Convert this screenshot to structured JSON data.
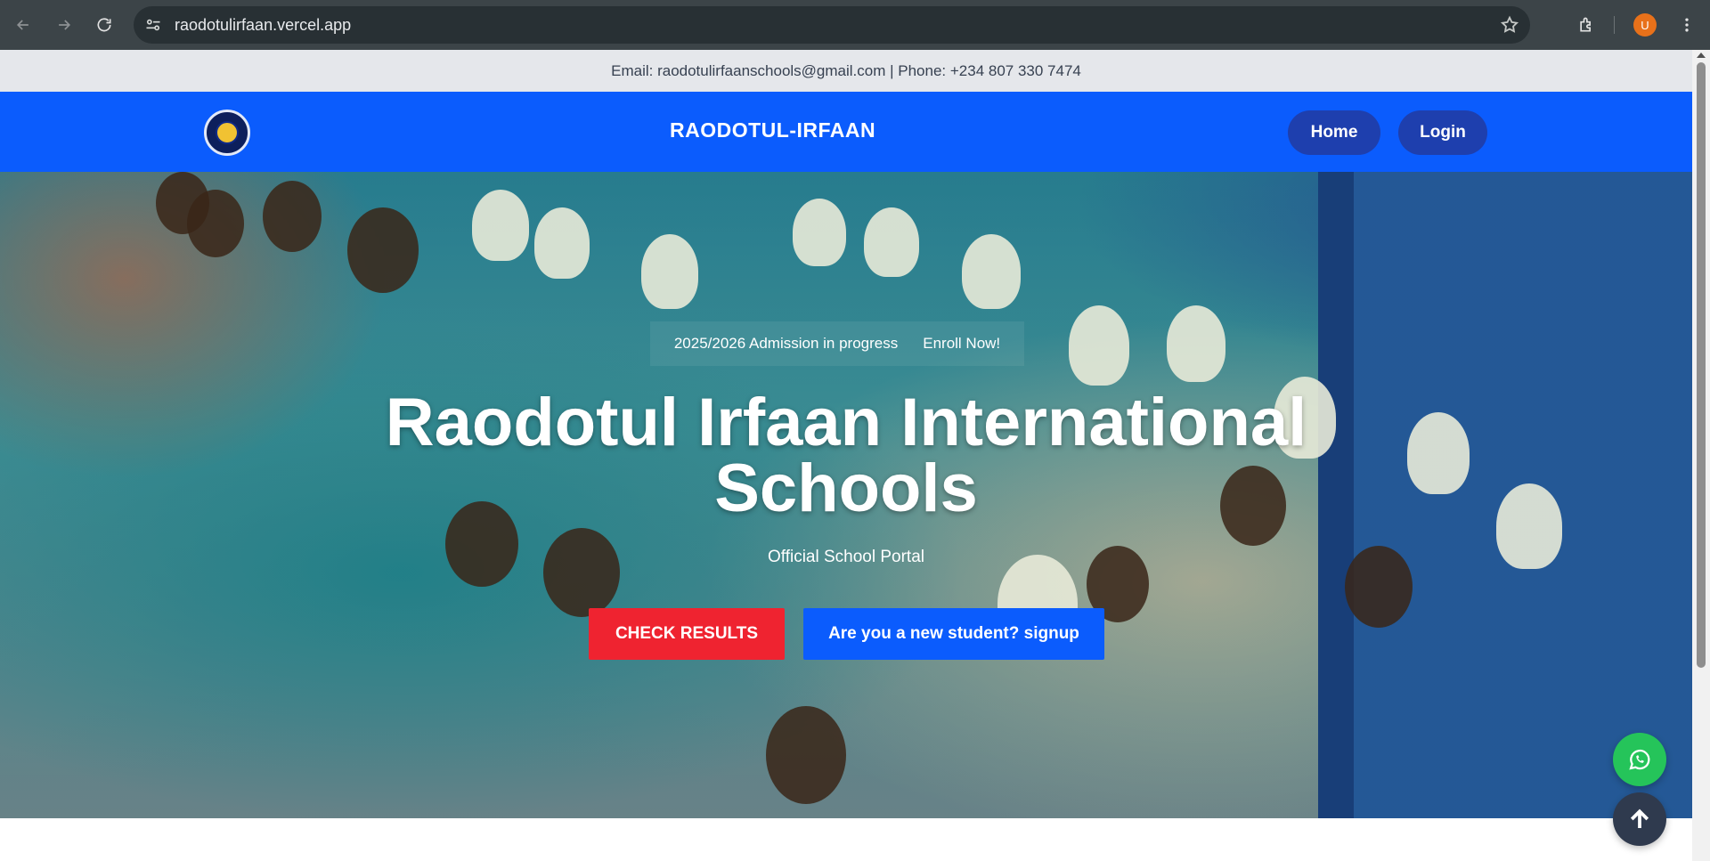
{
  "browser": {
    "url": "raodotulirfaan.vercel.app",
    "profile_initial": "U",
    "icons": [
      "back-icon",
      "forward-icon",
      "reload-icon",
      "site-settings-icon",
      "bookmark-star-icon",
      "extensions-icon",
      "menu-dots-icon"
    ]
  },
  "topbar": {
    "contact": "Email: raodotulirfaanschools@gmail.com | Phone: +234 807 330 7474"
  },
  "navbar": {
    "brand": "RAODOTUL-IRFAAN",
    "links": [
      {
        "label": "Home"
      },
      {
        "label": "Login"
      }
    ],
    "accent_color": "#0b5cfd"
  },
  "hero": {
    "admission_text": "2025/2026 Admission in progress",
    "enroll_text": "Enroll Now!",
    "title": "Raodotul Irfaan International Schools",
    "subtitle": "Official School Portal",
    "check_results_label": "CHECK RESULTS",
    "signup_label": "Are you a new student? signup"
  },
  "floating": {
    "whatsapp_icon": "whatsapp-icon",
    "to_top_icon": "arrow-up-icon"
  }
}
